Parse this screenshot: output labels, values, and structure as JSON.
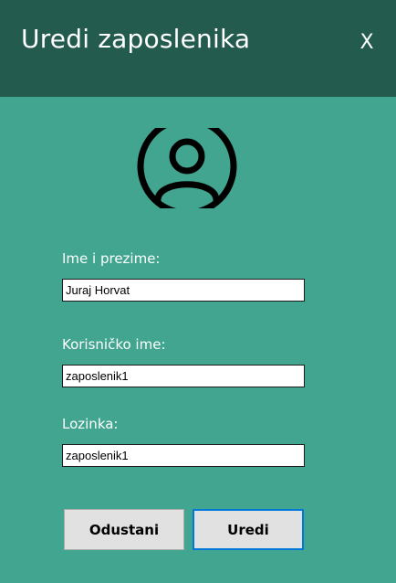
{
  "window": {
    "title": "Uredi zaposlenika",
    "close_label": "X"
  },
  "avatar": {
    "icon": "user-circle-icon"
  },
  "form": {
    "name": {
      "label": "Ime i prezime:",
      "value": "Juraj Horvat"
    },
    "username": {
      "label": "Korisničko ime:",
      "value": "zaposlenik1"
    },
    "password": {
      "label": "Lozinka:",
      "value": "zaposlenik1"
    }
  },
  "buttons": {
    "cancel_label": "Odustani",
    "edit_label": "Uredi"
  },
  "colors": {
    "background": "#41a58f",
    "titlebar": "#245b4f",
    "button_face": "#e1e1e1",
    "focus_border": "#0078d7"
  }
}
